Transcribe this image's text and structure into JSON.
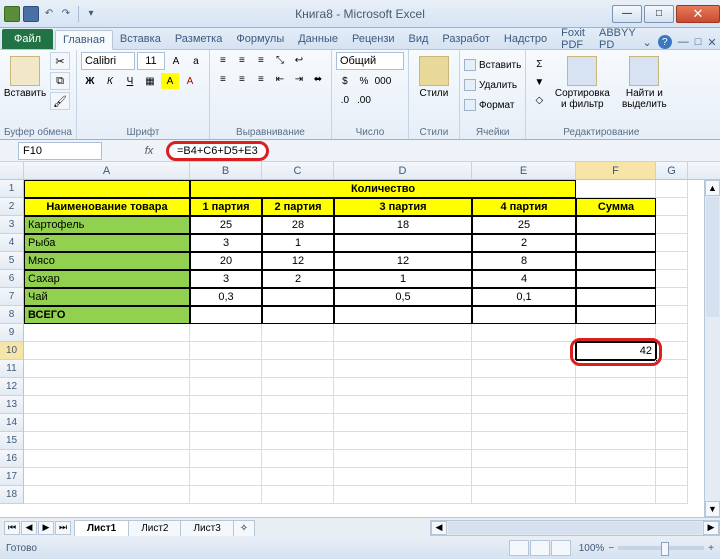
{
  "window": {
    "title": "Книга8 - Microsoft Excel"
  },
  "tabs": {
    "file": "Файл",
    "items": [
      "Главная",
      "Вставка",
      "Разметка",
      "Формулы",
      "Данные",
      "Рецензи",
      "Вид",
      "Разработ",
      "Надстро",
      "Foxit PDF",
      "ABBYY PD"
    ],
    "activeIndex": 0
  },
  "ribbon": {
    "paste": "Вставить",
    "clipboard": "Буфер обмена",
    "font": {
      "name": "Calibri",
      "size": "11",
      "label": "Шрифт"
    },
    "align": "Выравнивание",
    "number": {
      "format": "Общий",
      "label": "Число"
    },
    "styles": {
      "btn": "Стили",
      "label": "Стили"
    },
    "cells": {
      "insert": "Вставить",
      "delete": "Удалить",
      "format": "Формат",
      "label": "Ячейки"
    },
    "edit": {
      "sort": "Сортировка\nи фильтр",
      "find": "Найти и\nвыделить",
      "label": "Редактирование"
    }
  },
  "formula": {
    "namebox": "F10",
    "fx": "fx",
    "value": "=B4+C6+D5+E3"
  },
  "columns": [
    "A",
    "B",
    "C",
    "D",
    "E",
    "F",
    "G"
  ],
  "headers": {
    "qty": "Количество",
    "name": "Наименование товара",
    "p1": "1 партия",
    "p2": "2 партия",
    "p3": "3 партия",
    "p4": "4 партия",
    "sum": "Сумма"
  },
  "rows": [
    {
      "name": "Картофель",
      "b": "25",
      "c": "28",
      "d": "18",
      "e": "25"
    },
    {
      "name": "Рыба",
      "b": "3",
      "c": "1",
      "d": "",
      "e": "2"
    },
    {
      "name": "Мясо",
      "b": "20",
      "c": "12",
      "d": "12",
      "e": "8"
    },
    {
      "name": "Сахар",
      "b": "3",
      "c": "2",
      "d": "1",
      "e": "4"
    },
    {
      "name": "Чай",
      "b": "0,3",
      "c": "",
      "d": "0,5",
      "e": "0,1"
    }
  ],
  "total": "ВСЕГО",
  "result": "42",
  "sheets": [
    "Лист1",
    "Лист2",
    "Лист3"
  ],
  "status": {
    "ready": "Готово",
    "zoom": "100%"
  }
}
